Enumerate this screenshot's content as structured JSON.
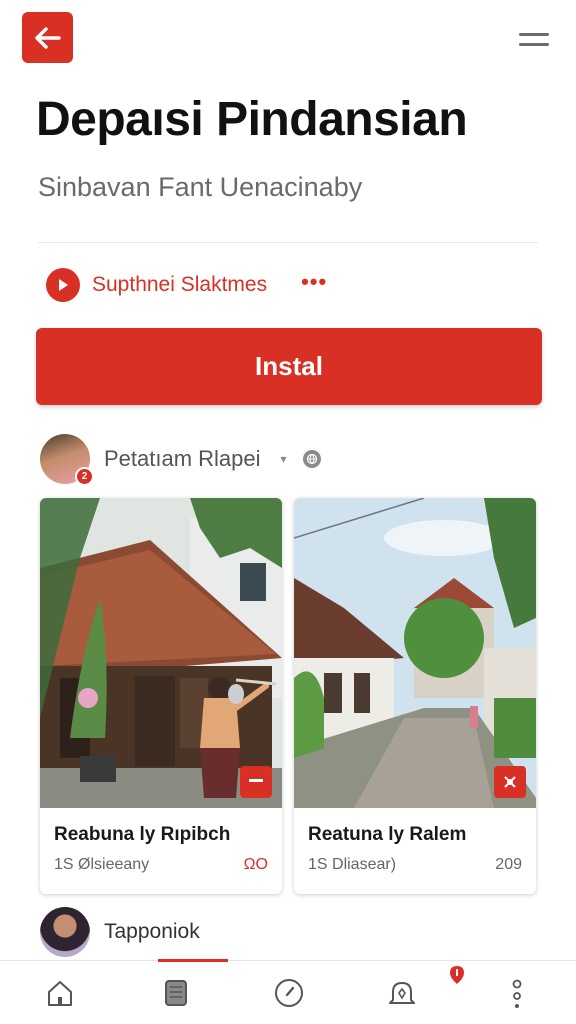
{
  "app": {
    "title": "Depaısi Pindansian",
    "subtitle": "Sinbavan Fant Uenacinaby",
    "accent_color": "#d93025"
  },
  "toolbar": {
    "back_icon": "arrow-left-icon",
    "menu_icon": "hamburger-menu-icon"
  },
  "seller": {
    "name": "Supthnei Slaktmes",
    "more_label": "•••"
  },
  "install": {
    "label": "Instal"
  },
  "author": {
    "name": "Petatıam Rlapei",
    "badge": "2",
    "caret": "▾"
  },
  "cards": [
    {
      "title": "Reabuna ly Rıpibch",
      "meta": "1S Ølsieeany",
      "count": "ΩO",
      "count_color": "red"
    },
    {
      "title": "Reatuna ly Ralem",
      "meta": "1S Dliasear)",
      "count": "209",
      "count_color": "gray"
    }
  ],
  "next_author": {
    "name": "Tapponiok"
  },
  "bottom_nav": [
    {
      "name": "home",
      "icon": "home-icon"
    },
    {
      "name": "library",
      "icon": "book-icon"
    },
    {
      "name": "explore",
      "icon": "compass-icon"
    },
    {
      "name": "notifications",
      "icon": "bell-icon"
    },
    {
      "name": "more",
      "icon": "more-vertical-icon"
    }
  ]
}
